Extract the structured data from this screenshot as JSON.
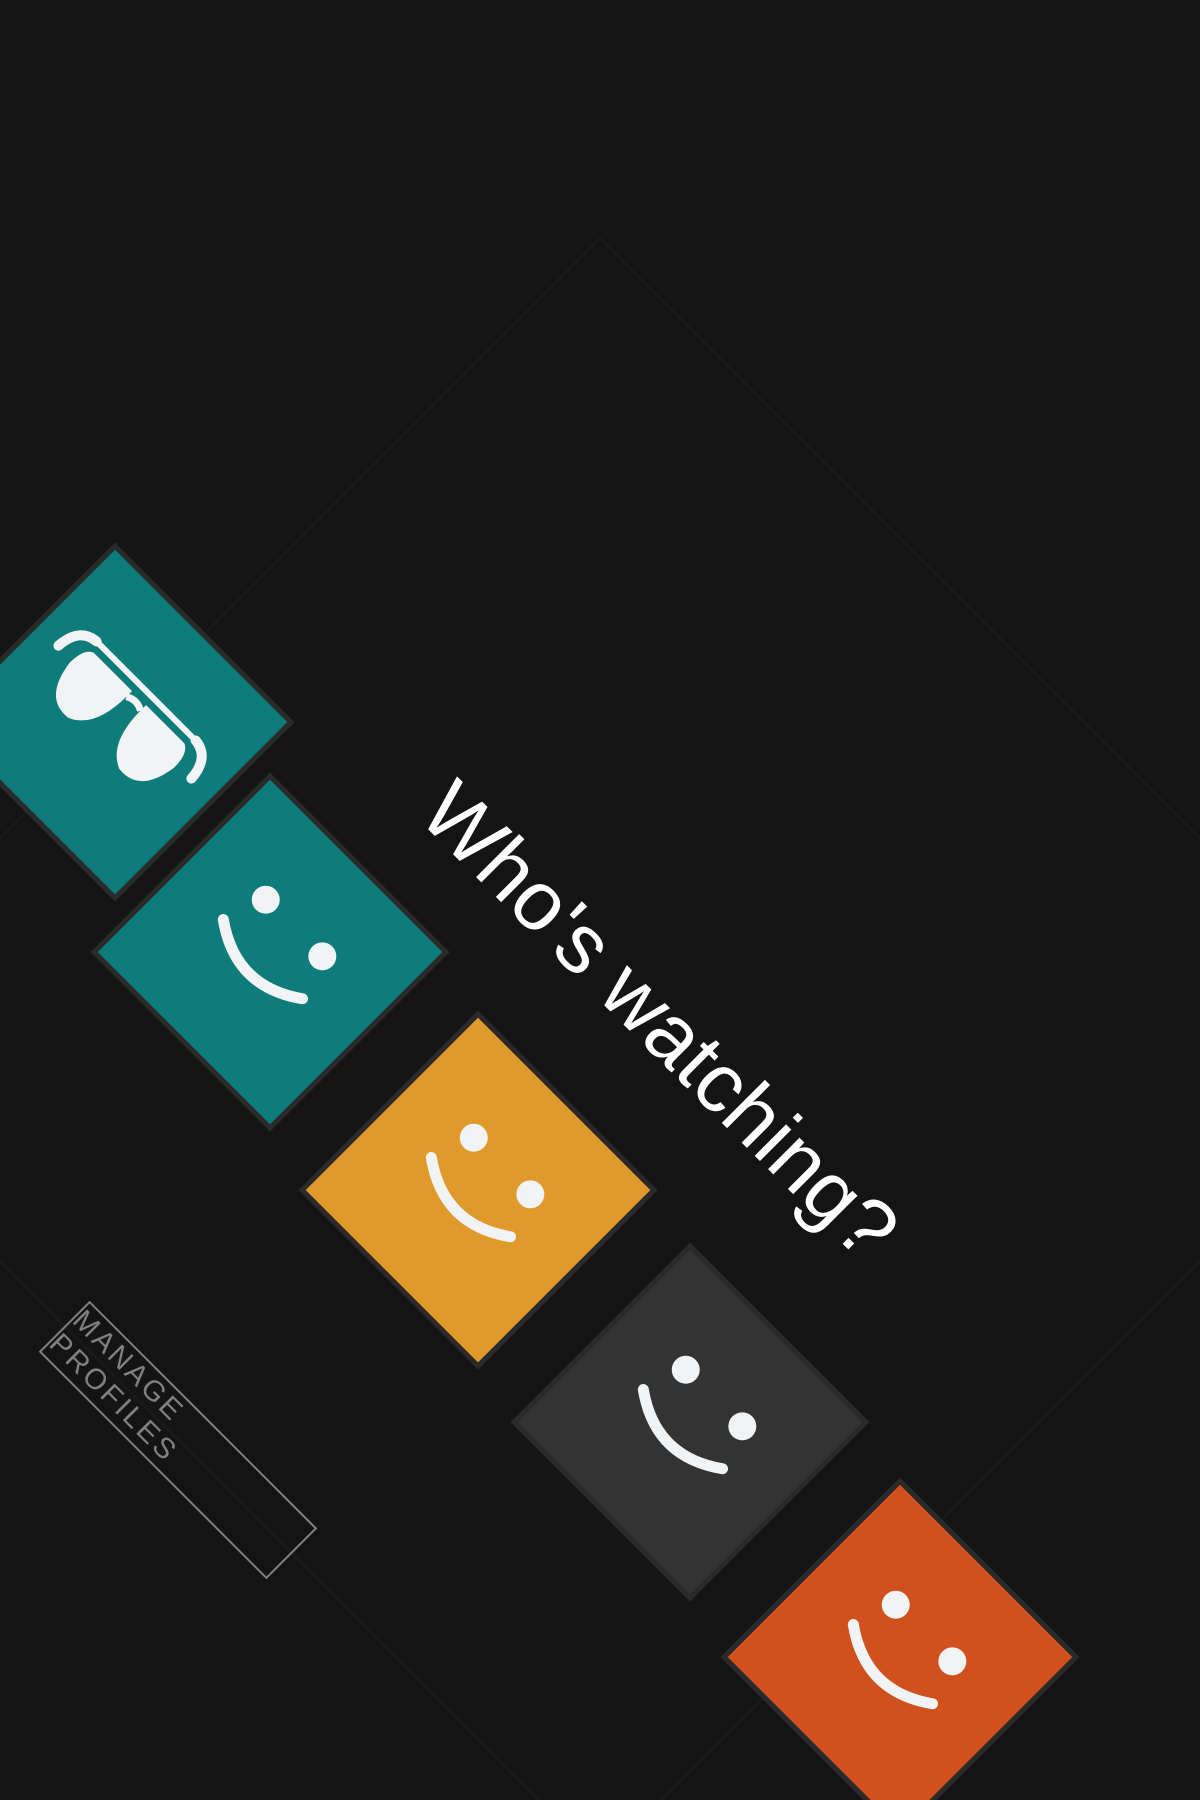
{
  "heading": "Who's watching?",
  "manage_profiles_label": "MANAGE PROFILES",
  "profiles": [
    {
      "color": "#0e7c7b",
      "avatar": "sunglasses-icon"
    },
    {
      "color": "#0e7c7b",
      "avatar": "smiley-face-icon"
    },
    {
      "color": "#df9a2b",
      "avatar": "smiley-face-icon"
    },
    {
      "color": "#333333",
      "avatar": "smiley-face-icon"
    },
    {
      "color": "#d0511e",
      "avatar": "smiley-face-icon"
    }
  ],
  "colors": {
    "background": "#141414",
    "text": "#ffffff",
    "muted": "#808080",
    "avatar_ink": "#f2f3f4"
  }
}
